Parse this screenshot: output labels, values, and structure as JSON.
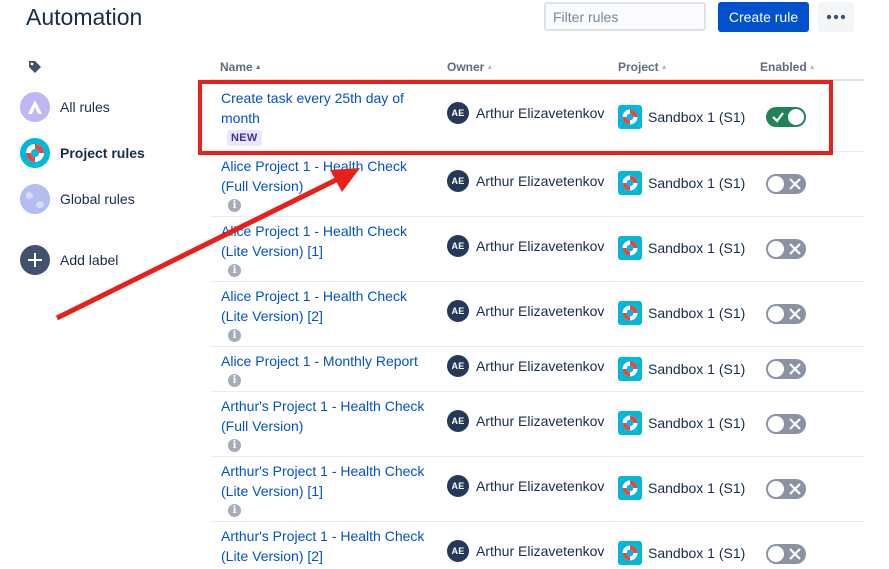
{
  "page": {
    "title": "Automation"
  },
  "toolbar": {
    "filter_placeholder": "Filter rules",
    "create_label": "Create rule",
    "more_icon": "more-horizontal-icon"
  },
  "sidebar": {
    "label_icon": "tag-icon",
    "items": [
      {
        "label": "All rules",
        "icon": "mountain-logo-icon"
      },
      {
        "label": "Project rules",
        "icon": "lifebuoy-icon",
        "active": true
      },
      {
        "label": "Global rules",
        "icon": "globe-icon"
      },
      {
        "label": "Add label",
        "icon": "plus-icon"
      }
    ]
  },
  "table": {
    "columns": [
      "Name",
      "Owner",
      "Project",
      "Enabled"
    ],
    "rows": [
      {
        "name_line1": "Create task every 25th day of",
        "name_line2": "month",
        "badge": "NEW",
        "owner_initials": "AE",
        "owner": "Arthur Elizavetenkov",
        "project": "Sandbox 1 (S1)",
        "enabled": true
      },
      {
        "name_line1": "Alice Project 1 - Health Check",
        "name_line2": "(Full Version)",
        "owner_initials": "AE",
        "owner": "Arthur Elizavetenkov",
        "project": "Sandbox 1 (S1)",
        "enabled": false
      },
      {
        "name_line1": "Alice Project 1 - Health Check",
        "name_line2": "(Lite Version) [1]",
        "owner_initials": "AE",
        "owner": "Arthur Elizavetenkov",
        "project": "Sandbox 1 (S1)",
        "enabled": false
      },
      {
        "name_line1": "Alice Project 1 - Health Check",
        "name_line2": "(Lite Version) [2]",
        "owner_initials": "AE",
        "owner": "Arthur Elizavetenkov",
        "project": "Sandbox 1 (S1)",
        "enabled": false
      },
      {
        "name_line1": "Alice Project 1 - Monthly Report",
        "name_line2": "",
        "owner_initials": "AE",
        "owner": "Arthur Elizavetenkov",
        "project": "Sandbox 1 (S1)",
        "enabled": false
      },
      {
        "name_line1": "Arthur's Project 1 - Health Check",
        "name_line2": "(Full Version)",
        "owner_initials": "AE",
        "owner": "Arthur Elizavetenkov",
        "project": "Sandbox 1 (S1)",
        "enabled": false
      },
      {
        "name_line1": "Arthur's Project 1 - Health Check",
        "name_line2": "(Lite Version) [1]",
        "owner_initials": "AE",
        "owner": "Arthur Elizavetenkov",
        "project": "Sandbox 1 (S1)",
        "enabled": false
      },
      {
        "name_line1": "Arthur's Project 1 - Health Check",
        "name_line2": "(Lite Version) [2]",
        "owner_initials": "AE",
        "owner": "Arthur Elizavetenkov",
        "project": "Sandbox 1 (S1)",
        "enabled": false
      }
    ]
  },
  "colors": {
    "link": "#0052cc",
    "primary": "#0052cc",
    "highlight": "#e8201a",
    "toggle_on": "#1f845a",
    "toggle_off": "#8993a4"
  }
}
